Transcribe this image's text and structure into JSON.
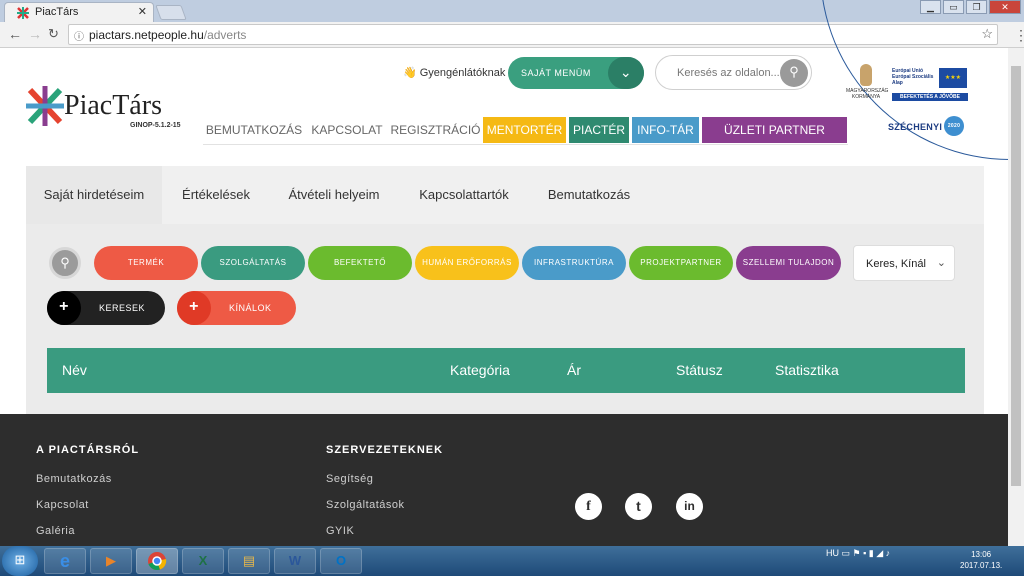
{
  "browser": {
    "tab_title": "PiacTárs",
    "url_host": "piactars.netpeople.hu",
    "url_path": "/adverts"
  },
  "header": {
    "logo_text": "PiacTárs",
    "logo_sub": "GINOP-5.1.2-15",
    "helper_link": "Gyengénlátóknak",
    "my_menu": "SAJÁT MENÜM",
    "search_placeholder": "Keresés az oldalon...",
    "eu_text_line1": "Európai Unió",
    "eu_text_line2": "Európai Szociális",
    "eu_text_line3": "Alap",
    "eu_slogan": "BEFEKTETÉS A JÖVŐBE",
    "hungary_text": "MAGYARORSZÁG KORMÁNYA",
    "szechenyi": "SZÉCHENYI",
    "szechenyi_badge": "2020"
  },
  "nav": [
    {
      "label": "BEMUTATKOZÁS",
      "color": ""
    },
    {
      "label": "KAPCSOLAT",
      "color": ""
    },
    {
      "label": "REGISZTRÁCIÓ",
      "color": ""
    },
    {
      "label": "MENTORTÉR",
      "color": "#f5b914"
    },
    {
      "label": "PIACTÉR",
      "color": "#2f8a70"
    },
    {
      "label": "INFO-TÁR",
      "color": "#4a9bc9"
    },
    {
      "label": "ÜZLETI PARTNER KERESŐ",
      "color": "#8a3d8f"
    }
  ],
  "page_tabs": [
    {
      "label": "Saját hirdetéseim",
      "active": true
    },
    {
      "label": "Értékelések",
      "active": false
    },
    {
      "label": "Átvételi helyeim",
      "active": false
    },
    {
      "label": "Kapcsolattartók",
      "active": false
    },
    {
      "label": "Bemutatkozás",
      "active": false
    }
  ],
  "categories": [
    {
      "label": "TERMÉK",
      "color": "#ee5a45"
    },
    {
      "label": "SZOLGÁLTATÁS",
      "color": "#3a9b80"
    },
    {
      "label": "BEFEKTETŐ",
      "color": "#6bbb2e"
    },
    {
      "label": "HUMÁN ERŐFORRÁS",
      "color": "#f8c11b"
    },
    {
      "label": "INFRASTRUKTÚRA",
      "color": "#4a9bc9"
    },
    {
      "label": "PROJEKTPARTNER",
      "color": "#6bbb2e"
    },
    {
      "label": "SZELLEMI TULAJDON",
      "color": "#8a3d8f"
    }
  ],
  "filter_select": "Keres, Kínál",
  "action_buttons": [
    {
      "label": "KERESEK",
      "color": "#222222"
    },
    {
      "label": "KÍNÁLOK",
      "color": "#ee5a45"
    }
  ],
  "table_headers": [
    "Név",
    "Kategória",
    "Ár",
    "Státusz",
    "Statisztika"
  ],
  "footer": {
    "col1_title": "A PIACTÁRSRÓL",
    "col1_links": [
      "Bemutatkozás",
      "Kapcsolat",
      "Galéria"
    ],
    "col2_title": "SZERVEZETEKNEK",
    "col2_links": [
      "Segítség",
      "Szolgáltatások",
      "GYIK"
    ],
    "social": [
      "f",
      "t",
      "in"
    ]
  },
  "taskbar": {
    "lang": "HU",
    "time": "13:06",
    "date": "2017.07.13."
  }
}
